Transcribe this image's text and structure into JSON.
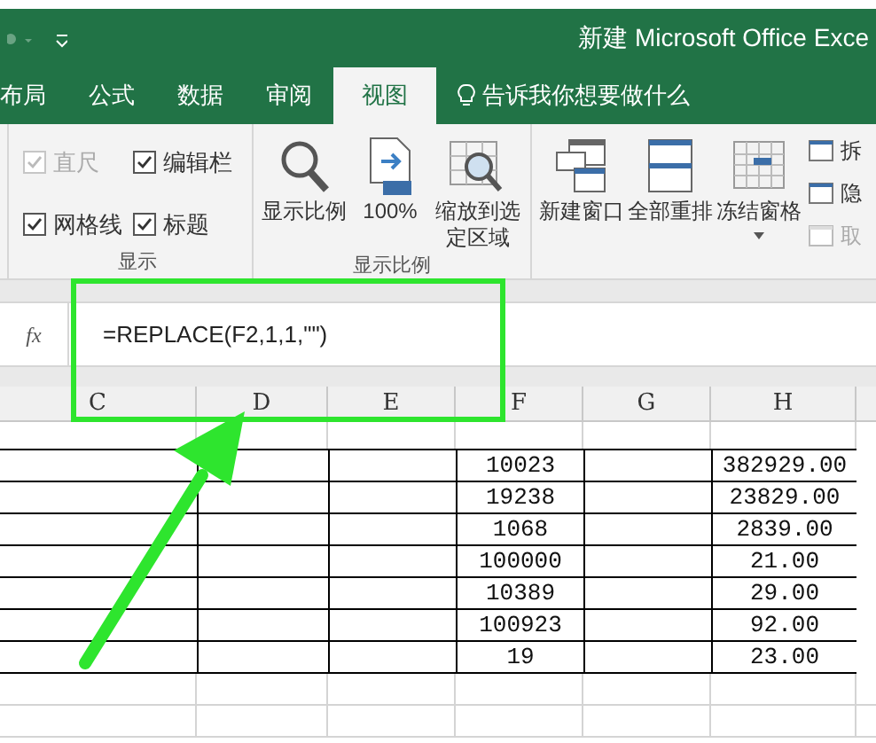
{
  "title_bar": {
    "title": "新建 Microsoft Office Exce"
  },
  "tabs": [
    {
      "label": "布局",
      "selected": false
    },
    {
      "label": "公式",
      "selected": false
    },
    {
      "label": "数据",
      "selected": false
    },
    {
      "label": "审阅",
      "selected": false
    },
    {
      "label": "视图",
      "selected": true
    }
  ],
  "tell_me": {
    "text": "告诉我你想要做什么"
  },
  "ribbon": {
    "show_group": {
      "label": "显示",
      "checkboxes": [
        {
          "label": "直尺",
          "checked": true,
          "disabled": true
        },
        {
          "label": "编辑栏",
          "checked": true,
          "disabled": false
        },
        {
          "label": "网格线",
          "checked": true,
          "disabled": false
        },
        {
          "label": "标题",
          "checked": true,
          "disabled": false
        }
      ]
    },
    "zoom_group": {
      "label": "显示比例",
      "buttons": [
        {
          "kind": "magnifier",
          "label": "显示比例"
        },
        {
          "kind": "hundred",
          "label": "100%"
        },
        {
          "kind": "zoom-selection",
          "label": "缩放到选定区域"
        }
      ]
    },
    "window_group": {
      "buttons": [
        {
          "kind": "new-window",
          "label": "新建窗口",
          "dropdown": false
        },
        {
          "kind": "arrange",
          "label": "全部重排",
          "dropdown": false
        },
        {
          "kind": "freeze",
          "label": "冻结窗格",
          "dropdown": true
        }
      ],
      "side_items": [
        {
          "label": "拆",
          "disabled": false
        },
        {
          "label": "隐",
          "disabled": false
        },
        {
          "label": "取",
          "disabled": true
        }
      ]
    }
  },
  "formula_bar": {
    "fx": "fx",
    "formula": "=REPLACE(F2,1,1,\"\")"
  },
  "sheet": {
    "columns": [
      "C",
      "D",
      "E",
      "F",
      "G",
      "H"
    ],
    "rows": [
      {
        "f": "10023",
        "h": "382929.00"
      },
      {
        "f": "19238",
        "h": "23829.00"
      },
      {
        "f": "1068",
        "h": "2839.00"
      },
      {
        "f": "100000",
        "h": "21.00"
      },
      {
        "f": "10389",
        "h": "29.00"
      },
      {
        "f": "100923",
        "h": "92.00"
      },
      {
        "f": "19",
        "h": "23.00"
      }
    ]
  }
}
